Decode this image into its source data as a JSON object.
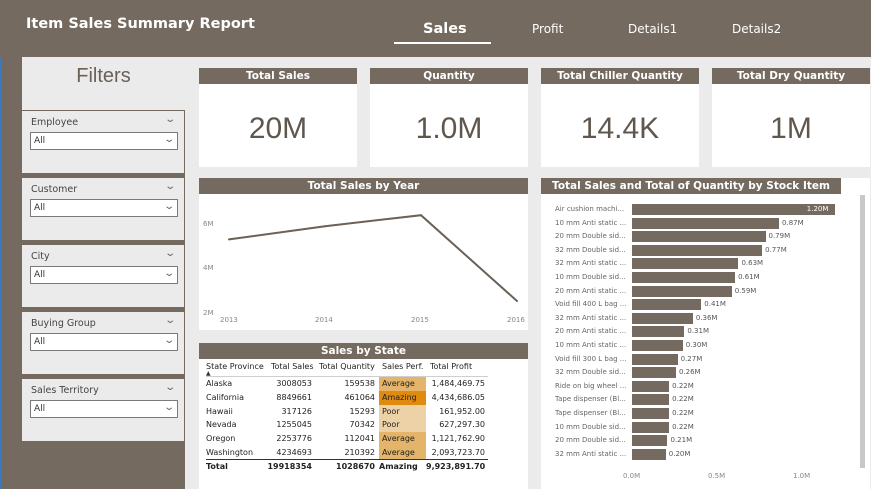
{
  "header": {
    "title": "Item Sales Summary Report",
    "tabs": [
      {
        "label": "Sales",
        "active": true
      },
      {
        "label": "Profit",
        "active": false
      },
      {
        "label": "Details1",
        "active": false
      },
      {
        "label": "Details2",
        "active": false
      }
    ]
  },
  "filters": {
    "title": "Filters",
    "slicers": [
      {
        "label": "Employee",
        "value": "All"
      },
      {
        "label": "Customer",
        "value": "All"
      },
      {
        "label": "City",
        "value": "All"
      },
      {
        "label": "Buying Group",
        "value": "All"
      },
      {
        "label": "Sales Territory",
        "value": "All"
      }
    ]
  },
  "cards": [
    {
      "title": "Total Sales",
      "value": "20M"
    },
    {
      "title": "Quantity",
      "value": "1.0M"
    },
    {
      "title": "Total Chiller Quantity",
      "value": "14.4K"
    },
    {
      "title": "Total Dry Quantity",
      "value": "1M"
    }
  ],
  "year_chart": {
    "title": "Total Sales by Year",
    "y_ticks": [
      "6M",
      "4M",
      "2M"
    ],
    "x_ticks": [
      "2013",
      "2014",
      "2015",
      "2016"
    ]
  },
  "state_table": {
    "title": "Sales by State",
    "columns": [
      "State Province",
      "Total Sales",
      "Total Quantity",
      "Sales Perf.",
      "Total Profit"
    ],
    "rows": [
      {
        "state": "Alaska",
        "sales": "3008053",
        "qty": "159538",
        "perf": "Average",
        "profit": "1,484,469.75"
      },
      {
        "state": "California",
        "sales": "8849661",
        "qty": "461064",
        "perf": "Amazing",
        "profit": "4,434,686.05"
      },
      {
        "state": "Hawaii",
        "sales": "317126",
        "qty": "15293",
        "perf": "Poor",
        "profit": "161,952.00"
      },
      {
        "state": "Nevada",
        "sales": "1255045",
        "qty": "70342",
        "perf": "Poor",
        "profit": "627,297.30"
      },
      {
        "state": "Oregon",
        "sales": "2253776",
        "qty": "112041",
        "perf": "Average",
        "profit": "1,121,762.90"
      },
      {
        "state": "Washington",
        "sales": "4234693",
        "qty": "210392",
        "perf": "Average",
        "profit": "2,093,723.70"
      }
    ],
    "total": {
      "state": "Total",
      "sales": "19918354",
      "qty": "1028670",
      "perf": "Amazing",
      "profit": "9,923,891.70"
    }
  },
  "perf_colors": {
    "Average": "#e3b469",
    "Amazing": "#e08a10",
    "Poor": "#ecd2a6"
  },
  "colors": {
    "accent": "#746a5f",
    "card_value": "#5f564d",
    "line": "#6b6157"
  },
  "chart_data": [
    {
      "type": "line",
      "title": "Total Sales by Year",
      "x": [
        2013,
        2014,
        2015,
        2016
      ],
      "values": [
        5.3,
        5.9,
        6.4,
        2.5
      ],
      "ylim": [
        2,
        6.6
      ],
      "yticks": [
        2,
        4,
        6
      ],
      "xlim": [
        2013,
        2016
      ],
      "grid": false,
      "legend": "none"
    },
    {
      "type": "bar",
      "orientation": "horizontal",
      "title": "Total Sales and Total of Quantity by Stock Item",
      "categories": [
        "Air cushion machi...",
        "10 mm Anti static ...",
        "20 mm Double sid...",
        "32 mm Double sid...",
        "32 mm Anti static ...",
        "10 mm Double sid...",
        "20 mm Anti static ...",
        "Void fill 400 L bag ...",
        "32 mm Anti static ...",
        "20 mm Anti static ...",
        "10 mm Anti static ...",
        "Void fill 300 L bag ...",
        "32 mm Double sid...",
        "Ride on big wheel ...",
        "Tape dispenser (Bl...",
        "Tape dispenser (Bl...",
        "10 mm Double sid...",
        "20 mm Double sid...",
        "32 mm Anti static ..."
      ],
      "values": [
        1.2,
        0.87,
        0.79,
        0.77,
        0.63,
        0.61,
        0.59,
        0.41,
        0.36,
        0.31,
        0.3,
        0.27,
        0.26,
        0.22,
        0.22,
        0.22,
        0.22,
        0.21,
        0.2
      ],
      "value_labels": [
        "1.20M",
        "0.87M",
        "0.79M",
        "0.77M",
        "0.63M",
        "0.61M",
        "0.59M",
        "0.41M",
        "0.36M",
        "0.31M",
        "0.30M",
        "0.27M",
        "0.26M",
        "0.22M",
        "0.22M",
        "0.22M",
        "0.22M",
        "0.21M",
        "0.20M"
      ],
      "x_ticks": [
        "0.0M",
        "0.5M",
        "1.0M"
      ],
      "xlim": [
        0,
        1.0
      ],
      "grid": false,
      "legend": "none"
    }
  ]
}
